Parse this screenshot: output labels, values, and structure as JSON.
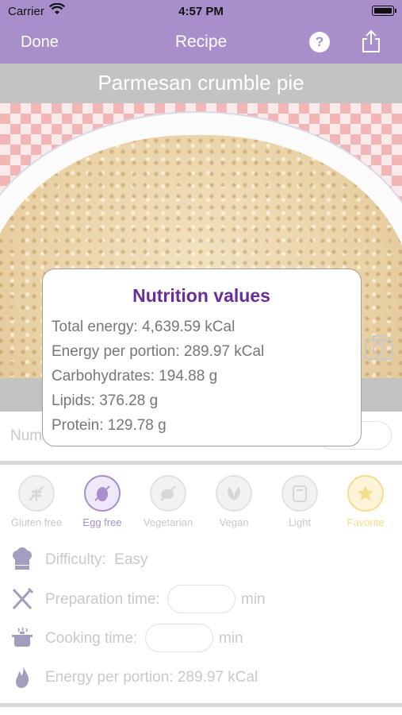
{
  "status_bar": {
    "carrier": "Carrier",
    "time": "4:57 PM"
  },
  "nav": {
    "done_label": "Done",
    "title": "Recipe"
  },
  "recipe": {
    "title": "Parmesan crumble pie"
  },
  "portions": {
    "label": "Num"
  },
  "tags": [
    {
      "label": "Gluten free",
      "icon": "wheat-icon",
      "active": false
    },
    {
      "label": "Egg free",
      "icon": "egg-icon",
      "active": true
    },
    {
      "label": "Vegetarian",
      "icon": "meat-icon",
      "active": false
    },
    {
      "label": "Vegan",
      "icon": "leaf-icon",
      "active": false
    },
    {
      "label": "Light",
      "icon": "scale-icon",
      "active": false
    },
    {
      "label": "Favorite",
      "icon": "star-icon",
      "active": true
    }
  ],
  "details": {
    "difficulty_label": "Difficulty:",
    "difficulty_value": "Easy",
    "prep_label": "Preparation time:",
    "prep_unit": "min",
    "cooking_label": "Cooking time:",
    "cooking_unit": "min",
    "energy_label": "Energy per portion:",
    "energy_value": "289.97 kCal"
  },
  "nutrition_popup": {
    "title": "Nutrition values",
    "lines": [
      "Total energy: 4,639.59 kCal",
      "Energy per portion: 289.97 kCal",
      "Carbohydrates: 194.88 g",
      "Lipids: 376.28 g",
      "Protein: 129.78 g"
    ]
  },
  "colors": {
    "accent": "#a88fcc",
    "popup_title": "#6a2c96",
    "favorite": "#f4dd8a"
  }
}
